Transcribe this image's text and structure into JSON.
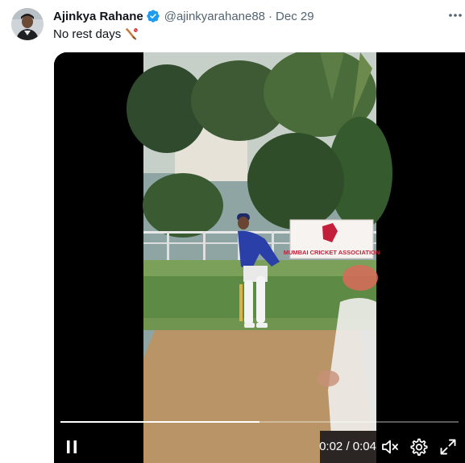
{
  "tweet": {
    "author_name": "Ajinkya Rahane",
    "handle": "@ajinkyarahane88",
    "separator": "·",
    "date": "Dec 29",
    "text": "No rest days",
    "verified_color": "#1d9bf0"
  },
  "video": {
    "banner_text": "MUMBAI CRICKET ASSOCIATION",
    "current_time": "0:02",
    "duration": "0:04",
    "time_separator": " / ",
    "progress": 0.5
  }
}
